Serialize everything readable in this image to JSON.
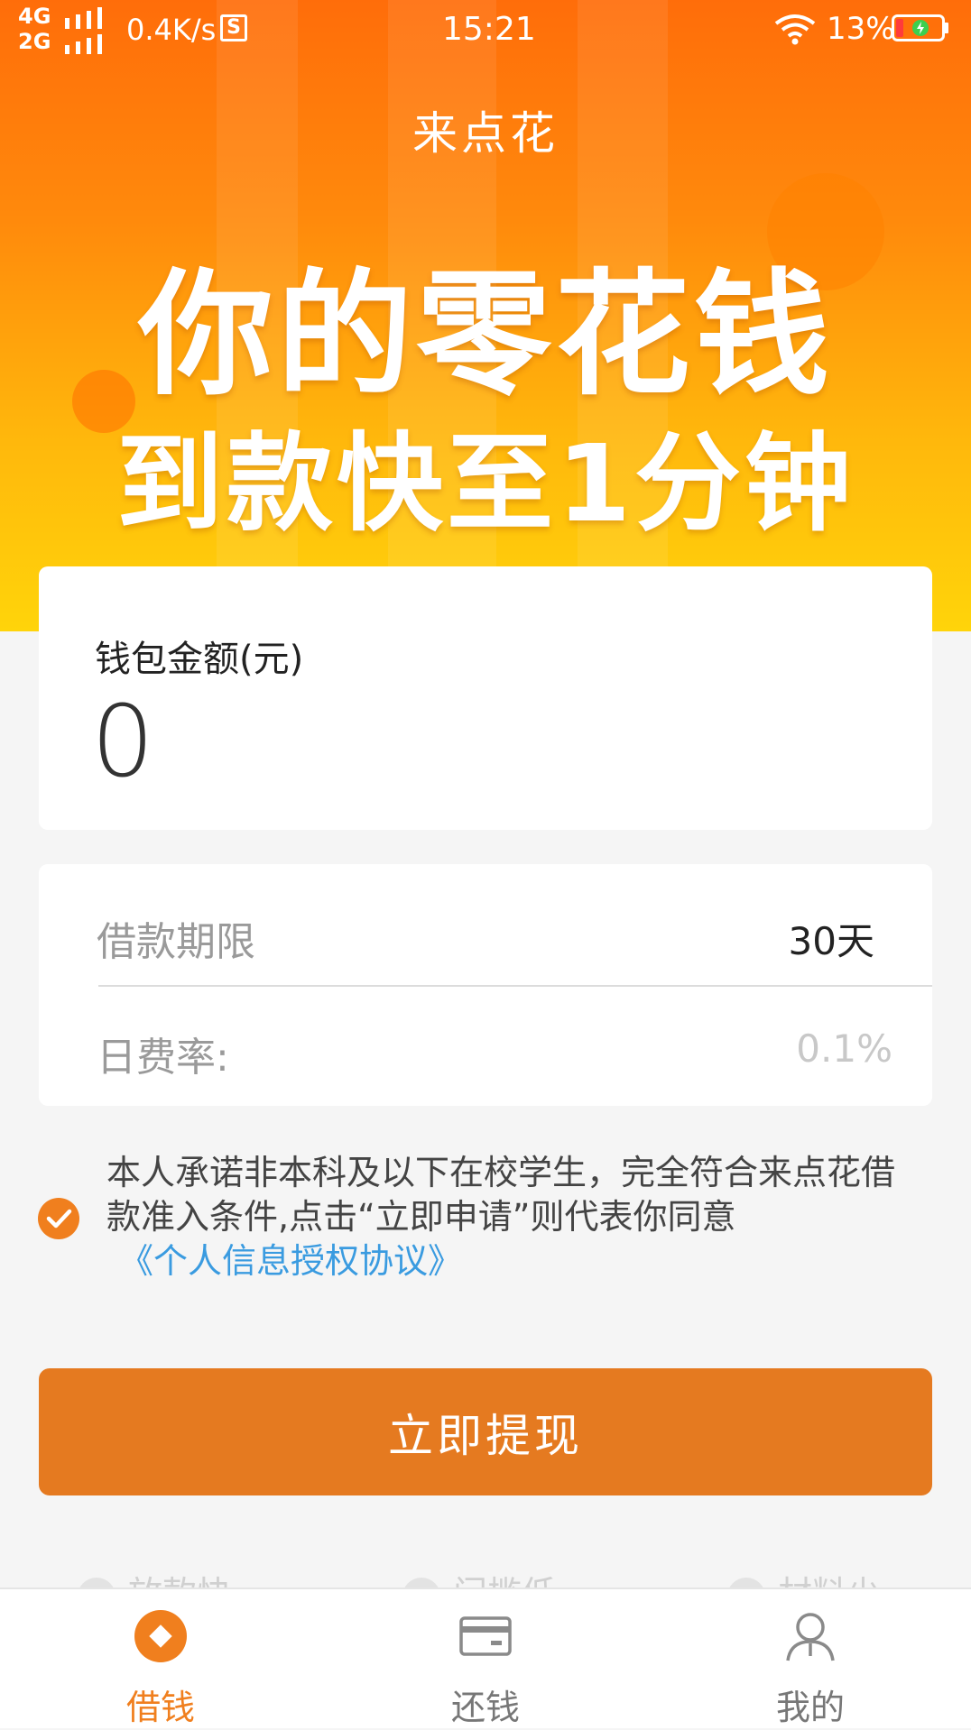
{
  "status_bar": {
    "network_top": "4G",
    "network_bottom": "2G",
    "speed": "0.4K/s",
    "s_icon_label": "S",
    "time": "15:21",
    "battery": "13%"
  },
  "app": {
    "title": "来点花"
  },
  "banner": {
    "headline_line1": "你的零花钱",
    "headline_line2": "到款快至1分钟"
  },
  "wallet": {
    "label": "钱包金额(元)",
    "amount": "0"
  },
  "loan": {
    "term_label": "借款期限",
    "term_value": "30天",
    "rate_label": "日费率:",
    "rate_value": "0.1%"
  },
  "agreement": {
    "text": "本人承诺非本科及以下在校学生，完全符合来点花借款准入条件,点击“立即申请”则代表你同意",
    "link": "《个人信息授权协议》",
    "checked": true
  },
  "cta": {
    "label": "立即提现"
  },
  "features": [
    {
      "label": "放款快",
      "icon": "lightning-icon"
    },
    {
      "label": "门槛低",
      "icon": "check-icon"
    },
    {
      "label": "材料少",
      "icon": "document-icon"
    }
  ],
  "tabs": [
    {
      "label": "借钱",
      "icon": "diamond-icon",
      "active": true
    },
    {
      "label": "还钱",
      "icon": "card-icon",
      "active": false
    },
    {
      "label": "我的",
      "icon": "user-icon",
      "active": false
    }
  ],
  "colors": {
    "accent": "#f07f1e",
    "button": "#e57a20",
    "link": "#3a9be0"
  }
}
